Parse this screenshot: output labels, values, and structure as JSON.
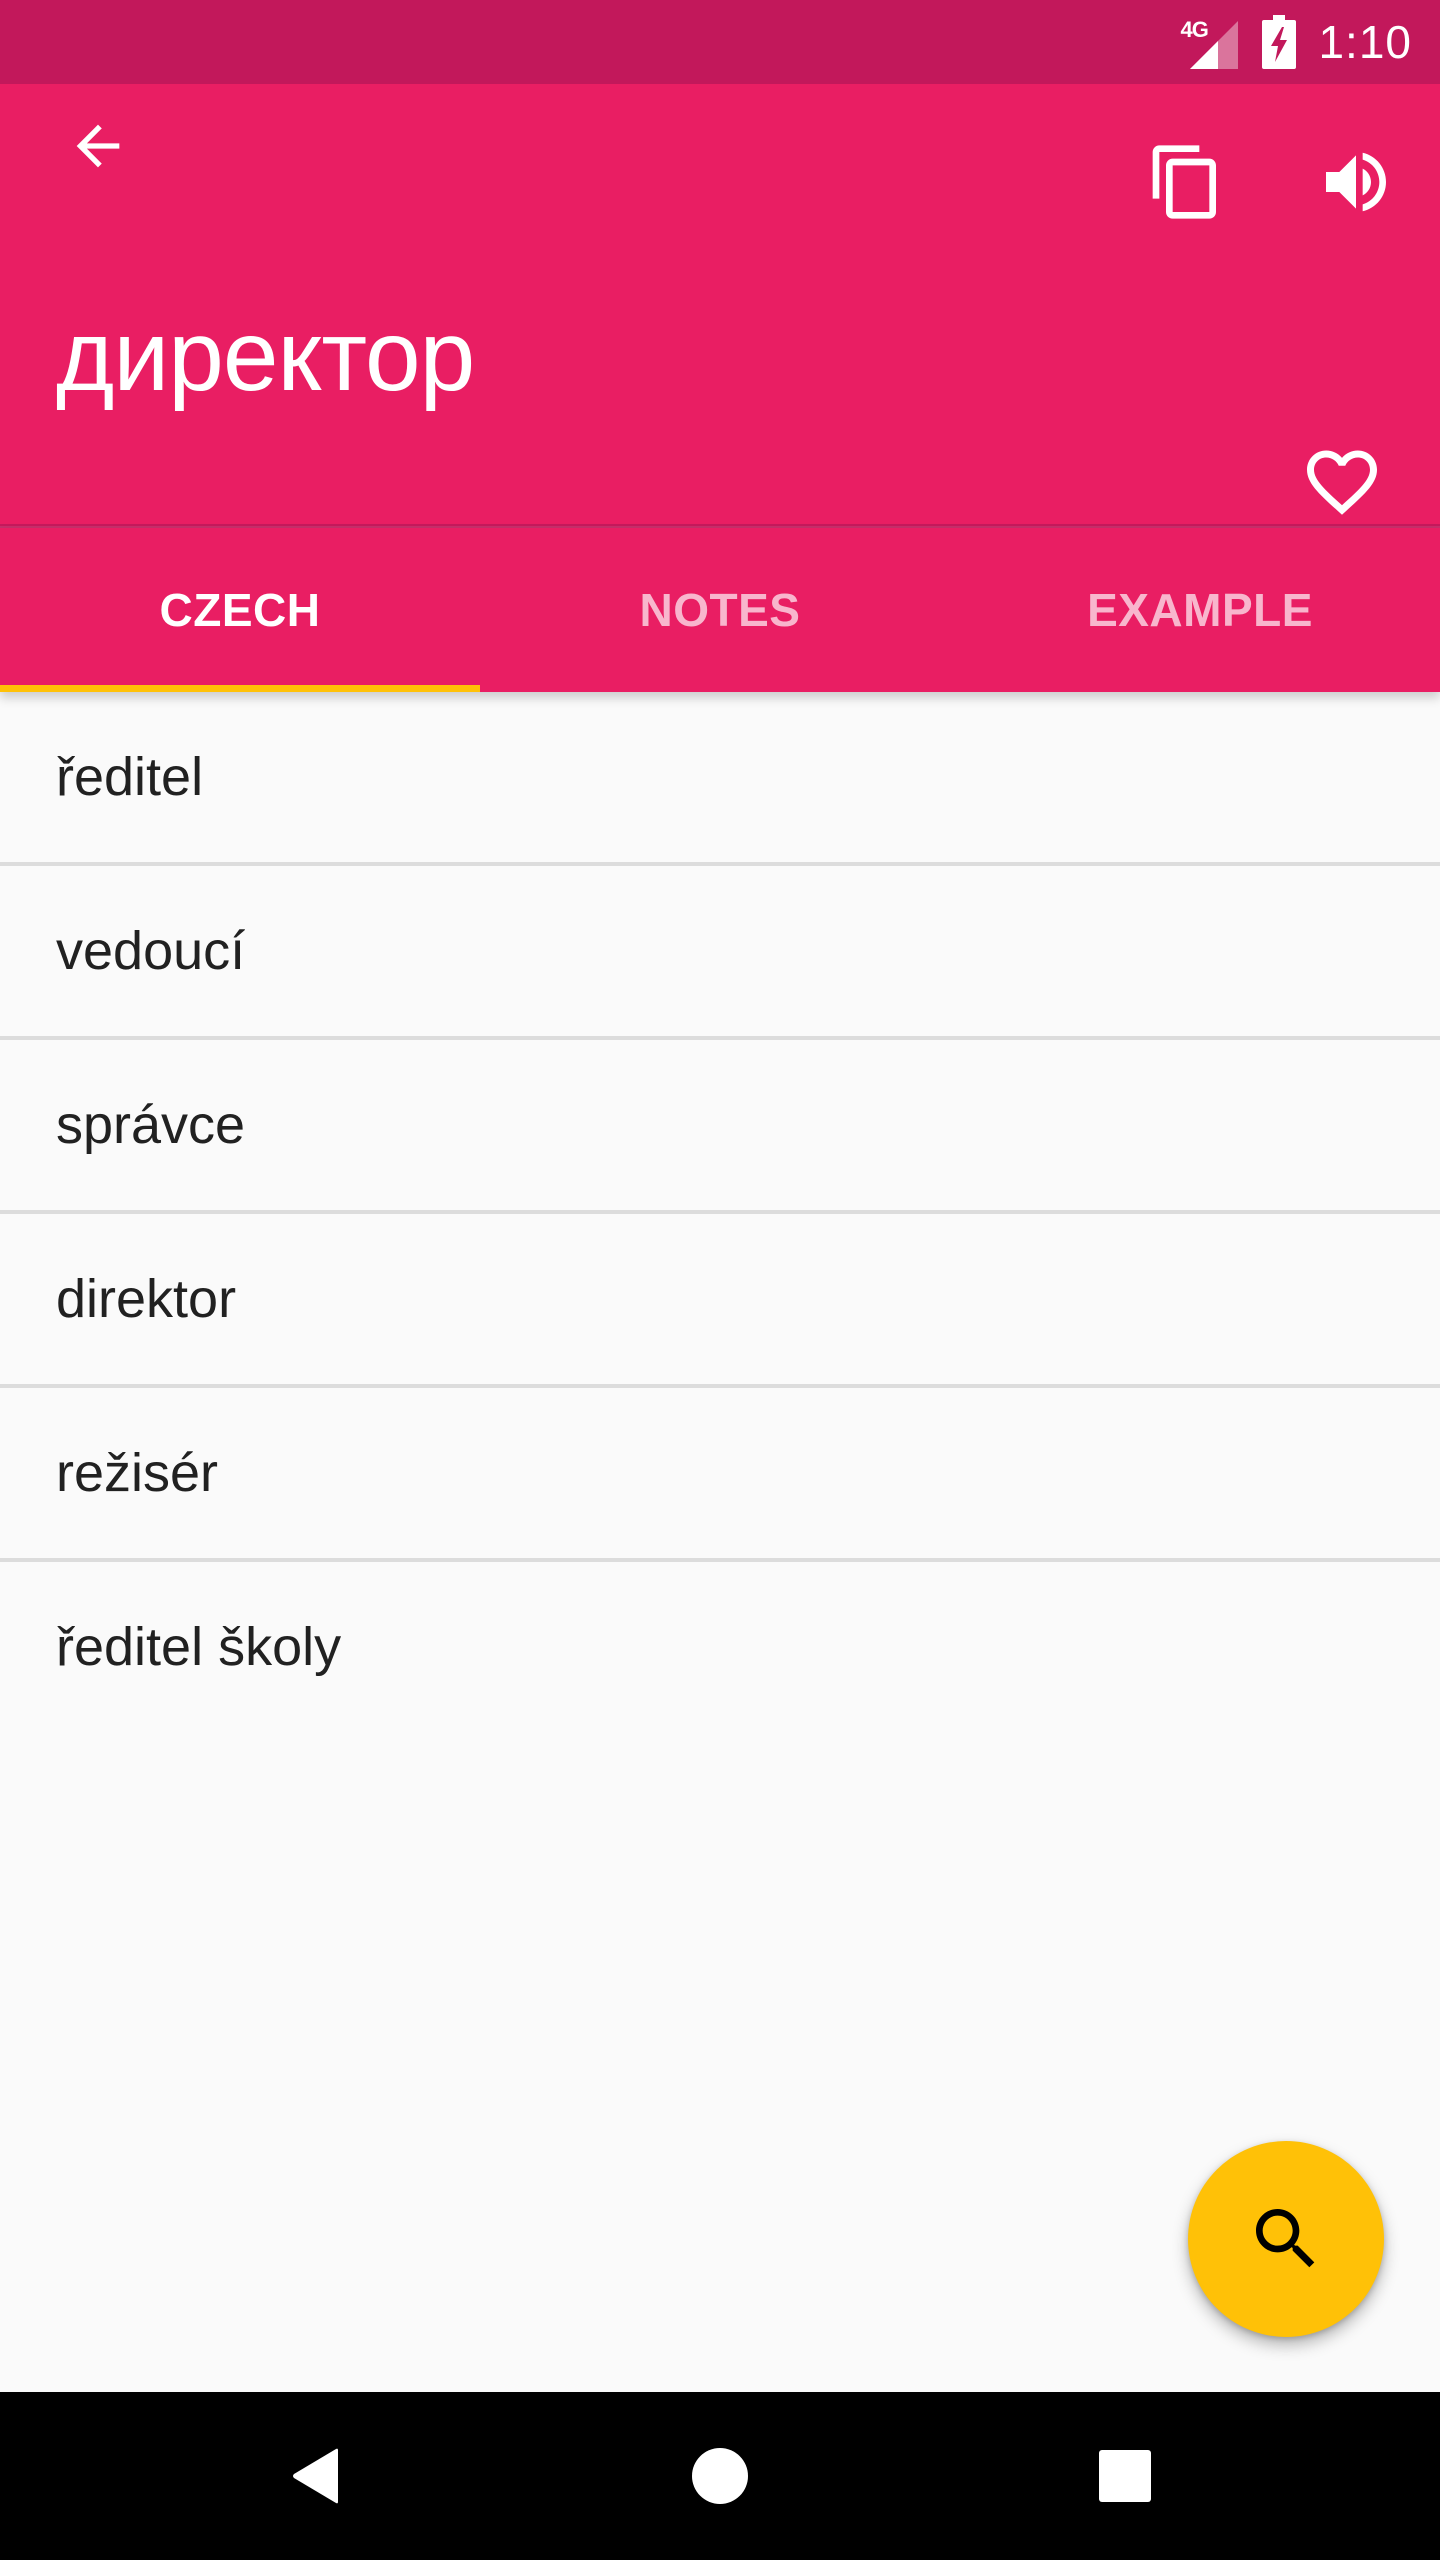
{
  "status_bar": {
    "network_label": "4G",
    "time": "1:10",
    "icons": [
      "signal-icon",
      "battery-charging-icon"
    ]
  },
  "app_bar": {
    "word": "директор",
    "actions": {
      "back": "back-arrow-icon",
      "copy": "copy-icon",
      "speak": "volume-icon",
      "favorite": "heart-outline-icon"
    }
  },
  "tabs": [
    {
      "label": "CZECH",
      "active": true
    },
    {
      "label": "NOTES",
      "active": false
    },
    {
      "label": "EXAMPLE",
      "active": false
    }
  ],
  "translations": [
    "ředitel",
    "vedoucí",
    "správce",
    "direktor",
    "režisér",
    "ředitel školy"
  ],
  "fab": {
    "icon": "search-icon"
  },
  "nav_bar": {
    "buttons": [
      "back",
      "home",
      "recents"
    ]
  },
  "colors": {
    "primary": "#e91e63",
    "primary_dark": "#c2185b",
    "accent": "#ffc107",
    "background": "#fafafa",
    "text": "#212121"
  }
}
